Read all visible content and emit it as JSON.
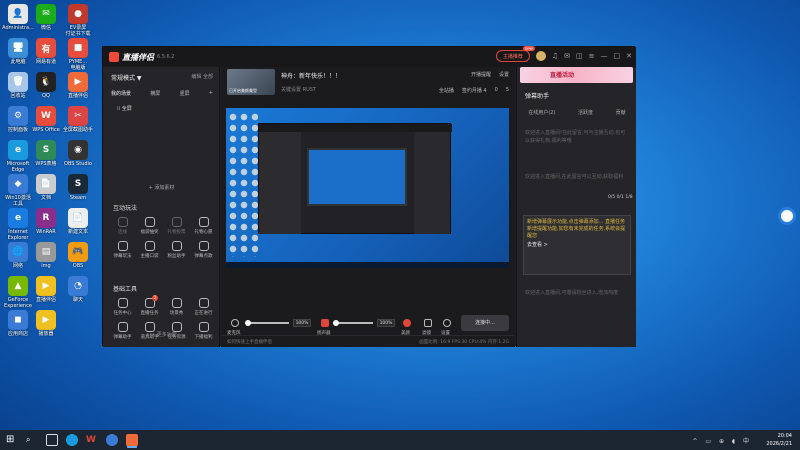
{
  "desktop": {
    "icons": [
      {
        "id": "admin",
        "label": "Administra...",
        "color": "#e6e6e6",
        "glyph": "👤"
      },
      {
        "id": "wechat",
        "label": "微信",
        "color": "#1aad19",
        "glyph": "✉"
      },
      {
        "id": "ev",
        "label": "EV录屏\n付证书下载",
        "color": "#c0392b",
        "glyph": "●"
      },
      {
        "id": "pc",
        "label": "此电脑",
        "color": "#3a8fd6",
        "glyph": "🖥"
      },
      {
        "id": "netease",
        "label": "网易有道",
        "color": "#e74c3c",
        "glyph": "有"
      },
      {
        "id": "pyme",
        "label": "PYME...\n电脑版",
        "color": "#e74c3c",
        "glyph": "■"
      },
      {
        "id": "recycle",
        "label": "回收站",
        "color": "#a7c6e8",
        "glyph": "🗑"
      },
      {
        "id": "qq",
        "label": "QQ",
        "color": "#222",
        "glyph": "🐧"
      },
      {
        "id": "live",
        "label": "直播伴侣",
        "color": "#f06a3a",
        "glyph": "▶"
      },
      {
        "id": "control",
        "label": "控制面板",
        "color": "#3a7bd6",
        "glyph": "⚙"
      },
      {
        "id": "wps",
        "label": "WPS Office",
        "color": "#e74c3c",
        "glyph": "W"
      },
      {
        "id": "shortcut",
        "label": "全屏截图助手",
        "color": "#d44",
        "glyph": "✂"
      },
      {
        "id": "edge",
        "label": "Microsoft\nEdge",
        "color": "#1a9be0",
        "glyph": "e"
      },
      {
        "id": "wps2",
        "label": "WPS表格",
        "color": "#2e8b57",
        "glyph": "S"
      },
      {
        "id": "obs",
        "label": "OBS Studio",
        "color": "#333",
        "glyph": "◉"
      },
      {
        "id": "win",
        "label": "Win10激活\n工具",
        "color": "#3a7bd6",
        "glyph": "◆"
      },
      {
        "id": "doc",
        "label": "文档",
        "color": "#ccc",
        "glyph": "📄"
      },
      {
        "id": "steam",
        "label": "Steam",
        "color": "#1b2838",
        "glyph": "S"
      },
      {
        "id": "ie",
        "label": "Internet\nExplorer",
        "color": "#1a7be0",
        "glyph": "e"
      },
      {
        "id": "rar",
        "label": "WinRAR",
        "color": "#8b2d8b",
        "glyph": "R"
      },
      {
        "id": "txt",
        "label": "新建文本",
        "color": "#eee",
        "glyph": "📄"
      },
      {
        "id": "net",
        "label": "网络",
        "color": "#3a7bd6",
        "glyph": "🌐"
      },
      {
        "id": "img",
        "label": "img",
        "color": "#999",
        "glyph": "▤"
      },
      {
        "id": "obs2",
        "label": "OBS",
        "color": "#f39c12",
        "glyph": "🎮"
      },
      {
        "id": "geforce",
        "label": "GeForce\nExperience",
        "color": "#76b900",
        "glyph": "▲"
      },
      {
        "id": "live2",
        "label": "直播伴侣",
        "color": "#f0c020",
        "glyph": "▶"
      },
      {
        "id": "chat",
        "label": "聊天",
        "color": "#3a7bd6",
        "glyph": "◔"
      },
      {
        "id": "store",
        "label": "应用商店",
        "color": "#3a7bd6",
        "glyph": "◼"
      },
      {
        "id": "play",
        "label": "播放器",
        "color": "#f0c020",
        "glyph": "▶"
      }
    ]
  },
  "app": {
    "name": "直播伴侣",
    "version": "6.5.6.2",
    "vip_label": "主播推荐",
    "vip_badge": "new",
    "left": {
      "mode": "常规模式 ▼",
      "mode_right": "编辑  全部",
      "scene_tabs": [
        "我的场景",
        "横屏",
        "竖屏"
      ],
      "scene_add": "+",
      "scene_item": "全屏",
      "add_source": "+ 添加素材",
      "interactive_title": "互动玩法",
      "interactive_tools": [
        {
          "name": "连线",
          "dim": true
        },
        {
          "name": "福袋抽奖",
          "dim": false
        },
        {
          "name": "礼物投票",
          "dim": true
        },
        {
          "name": "礼物心愿",
          "dim": false
        },
        {
          "name": "弹幕玩法",
          "dim": false
        },
        {
          "name": "主播口袋",
          "dim": false
        },
        {
          "name": "粉丝助手",
          "dim": false
        },
        {
          "name": "弹幕点歌",
          "dim": false
        }
      ],
      "basic_title": "基础工具",
      "basic_tools": [
        {
          "name": "任务中心",
          "badge": ""
        },
        {
          "name": "直播任务",
          "badge": "2"
        },
        {
          "name": "场景秀",
          "badge": ""
        },
        {
          "name": "正在进行",
          "badge": ""
        },
        {
          "name": "弹幕助手",
          "badge": ""
        },
        {
          "name": "道具助手",
          "badge": ""
        },
        {
          "name": "任务资源",
          "badge": ""
        },
        {
          "name": "下播福利",
          "badge": ""
        }
      ],
      "more": "••• 更多功能"
    },
    "center": {
      "channel_title": "神舟：新年快乐！！！",
      "thumb_caption": "已开启美颜美型",
      "channel_sub": "关键设置  RUST",
      "actions_top": [
        "开播提醒",
        "设置"
      ],
      "actions_bottom": [
        "全站播",
        "签约月播 4",
        "0",
        "5"
      ],
      "mic_label": "麦克风",
      "mic_pct": "100%",
      "speaker_label": "扬声器",
      "speaker_pct": "100%",
      "ctrl_labels": [
        "美颜",
        "滤镜",
        "设置"
      ],
      "live_button": "连接中...",
      "status_left": "如何快速上手直播伴侣",
      "status_right": "画面比例: 16:9  FPS:30  CPU:4%  内存:1.2G"
    },
    "right": {
      "banner": "直播活动",
      "title": "弹幕助手",
      "tabs": [
        "在线用户(2)",
        "活跃度",
        "贡献"
      ],
      "msgs": [
        "欢迎进入直播间!在此留言,可与主播互动,也可以获得礼物,福利等哦",
        "欢迎进入直播间,在此留言可以互动,获取福利"
      ],
      "badge": "0/5 0/1 1/8",
      "box_text": "新增弹幕展示功能,点击弹幕添加...  直播任务新增提醒功能,如您有未完成的任务,系统会提醒您",
      "box_go": "去查看 >",
      "bottom_msg": "欢迎进入直播间,可邀请粉丝进入,增加热度"
    }
  },
  "taskbar": {
    "time": "20:04",
    "date": "2026/2/21",
    "tray": "^ ▭ ⊕ ◖ 中"
  }
}
